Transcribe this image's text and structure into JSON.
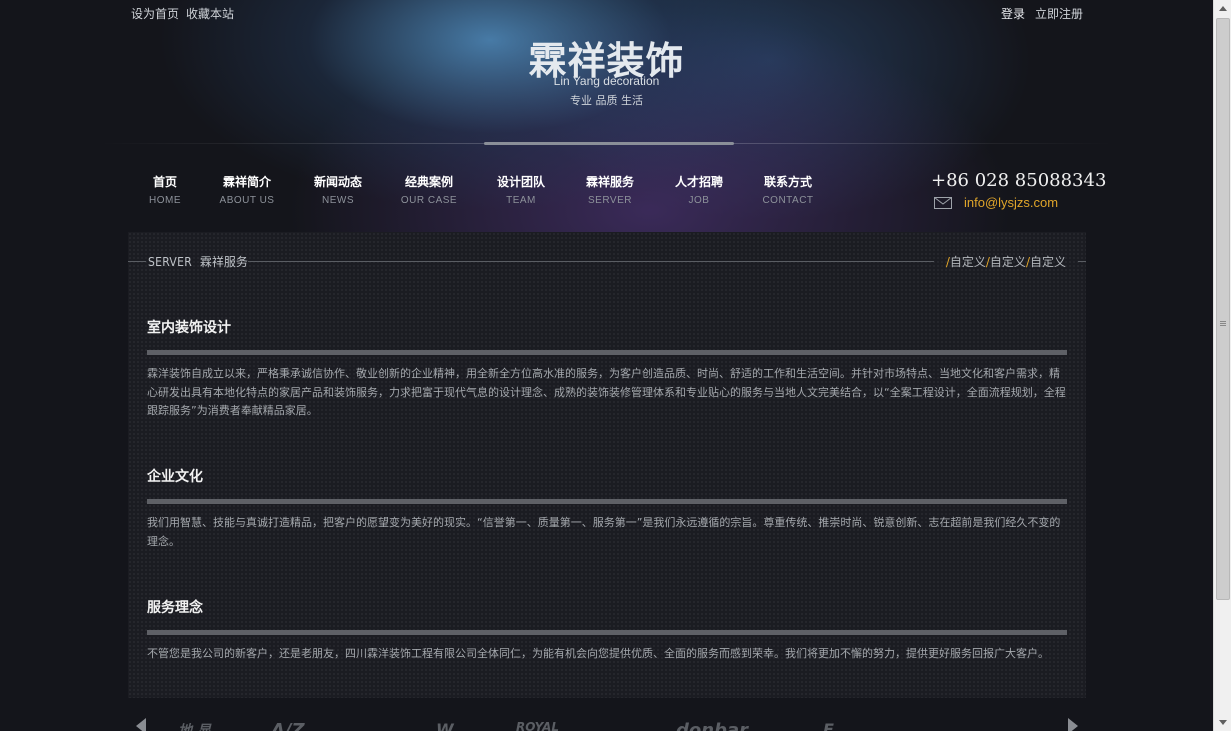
{
  "topbar": {
    "set_home": "设为首页",
    "bookmark": "收藏本站",
    "login": "登录",
    "register": "立即注册"
  },
  "logo": {
    "title": "霖祥装饰",
    "subtitle": "Lin Yang decoration",
    "slogan": "专业 品质 生活"
  },
  "nav": [
    {
      "zh": "首页",
      "en": "HOME"
    },
    {
      "zh": "霖祥简介",
      "en": "ABOUT US"
    },
    {
      "zh": "新闻动态",
      "en": "NEWS"
    },
    {
      "zh": "经典案例",
      "en": "OUR CASE"
    },
    {
      "zh": "设计团队",
      "en": "TEAM"
    },
    {
      "zh": "霖祥服务",
      "en": "SERVER"
    },
    {
      "zh": "人才招聘",
      "en": "JOB"
    },
    {
      "zh": "联系方式",
      "en": "CONTACT"
    }
  ],
  "contact": {
    "phone": "+86 028 85088343",
    "email": "info@lysjzs.com"
  },
  "section": {
    "title_en": "SERVER",
    "title_zh": "霖祥服务",
    "custom_links": [
      "自定义",
      "自定义",
      "自定义"
    ]
  },
  "blocks": [
    {
      "title": "室内装饰设计",
      "text": "霖洋装饰自成立以来，严格秉承诚信协作、敬业创新的企业精神，用全新全方位高水准的服务，为客户创造品质、时尚、舒适的工作和生活空间。并针对市场特点、当地文化和客户需求，精心研发出具有本地化特点的家居产品和装饰服务，力求把富于现代气息的设计理念、成熟的装饰装修管理体系和专业贴心的服务与当地人文完美结合，以“全案工程设计，全面流程规划，全程跟踪服务”为消费者奉献精品家居。"
    },
    {
      "title": "企业文化",
      "text": "我们用智慧、技能与真诚打造精品，把客户的愿望变为美好的现实。“信誉第一、质量第一、服务第一”是我们永远遵循的宗旨。尊重传统、推崇时尚、锐意创新、志在超前是我们经久不变的理念。"
    },
    {
      "title": "服务理念",
      "text": "不管您是我公司的新客户，还是老朋友，四川霖洋装饰工程有限公司全体同仁，为能有机会向您提供优质、全面的服务而感到荣幸。我们将更加不懈的努力，提供更好服务回报广大客户。"
    }
  ],
  "partners": [
    "地 显",
    "A/Z",
    "W",
    "ROYAL",
    "donbar",
    "F"
  ],
  "colors": {
    "accent": "#e0a52a",
    "background": "#14151b",
    "panel": "#1b1c22"
  }
}
